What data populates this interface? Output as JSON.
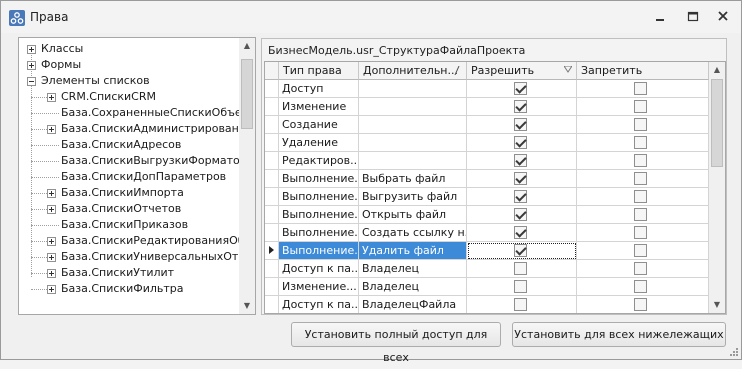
{
  "window": {
    "title": "Права",
    "colors": {
      "selection": "#3c8ad8",
      "border": "#a7a7a7"
    }
  },
  "tree": {
    "items": [
      {
        "label": "Классы",
        "expander": "plus",
        "level": 0
      },
      {
        "label": "Формы",
        "expander": "plus",
        "level": 0
      },
      {
        "label": "Элементы списков",
        "expander": "minus",
        "level": 0
      },
      {
        "label": "CRM.СпискиCRM",
        "expander": "plus",
        "level": 1
      },
      {
        "label": "База.СохраненныеСпискиОбъектов",
        "expander": "none",
        "level": 1
      },
      {
        "label": "База.СпискиАдминистрирования",
        "expander": "plus",
        "level": 1
      },
      {
        "label": "База.СпискиАдресов",
        "expander": "none",
        "level": 1
      },
      {
        "label": "База.СпискиВыгрузкиФорматов",
        "expander": "none",
        "level": 1
      },
      {
        "label": "База.СпискиДопПараметров",
        "expander": "none",
        "level": 1
      },
      {
        "label": "База.СпискиИмпорта",
        "expander": "plus",
        "level": 1
      },
      {
        "label": "База.СпискиОтчетов",
        "expander": "plus",
        "level": 1
      },
      {
        "label": "База.СпискиПриказов",
        "expander": "none",
        "level": 1
      },
      {
        "label": "База.СпискиРедактированияОбъектов",
        "expander": "plus",
        "level": 1
      },
      {
        "label": "База.СпискиУниверсальныхОтчетов",
        "expander": "plus",
        "level": 1
      },
      {
        "label": "База.СпискиУтилит",
        "expander": "plus",
        "level": 1
      },
      {
        "label": "База.СпискиФильтра",
        "expander": "plus",
        "level": 1
      }
    ]
  },
  "panel": {
    "caption": "БизнесМодель.usr_СтруктураФайлаПроекта",
    "columns": [
      "Тип права",
      "Дополнительн...",
      "Разрешить",
      "Запретить"
    ],
    "rows": [
      {
        "type": "Доступ",
        "extra": "",
        "allow": true,
        "deny": false
      },
      {
        "type": "Изменение",
        "extra": "",
        "allow": true,
        "deny": false
      },
      {
        "type": "Создание",
        "extra": "",
        "allow": true,
        "deny": false
      },
      {
        "type": "Удаление",
        "extra": "",
        "allow": true,
        "deny": false
      },
      {
        "type": "Редактиров...",
        "extra": "",
        "allow": true,
        "deny": false
      },
      {
        "type": "Выполнение...",
        "extra": "Выбрать файл",
        "allow": true,
        "deny": false
      },
      {
        "type": "Выполнение...",
        "extra": "Выгрузить файл",
        "allow": true,
        "deny": false
      },
      {
        "type": "Выполнение...",
        "extra": "Открыть файл",
        "allow": true,
        "deny": false
      },
      {
        "type": "Выполнение...",
        "extra": "Создать ссылку н...",
        "allow": true,
        "deny": false
      },
      {
        "type": "Выполнение...",
        "extra": "Удалить файл",
        "allow": true,
        "deny": false,
        "selected": true
      },
      {
        "type": "Доступ к па...",
        "extra": "Владелец",
        "allow": false,
        "deny": false
      },
      {
        "type": "Изменение...",
        "extra": "Владелец",
        "allow": false,
        "deny": false
      },
      {
        "type": "Доступ к па...",
        "extra": "ВладелецФайла",
        "allow": false,
        "deny": false
      }
    ]
  },
  "buttons": {
    "full_access": "Установить полный доступ для всех",
    "apply_children": "Установить для всех нижележащих"
  }
}
